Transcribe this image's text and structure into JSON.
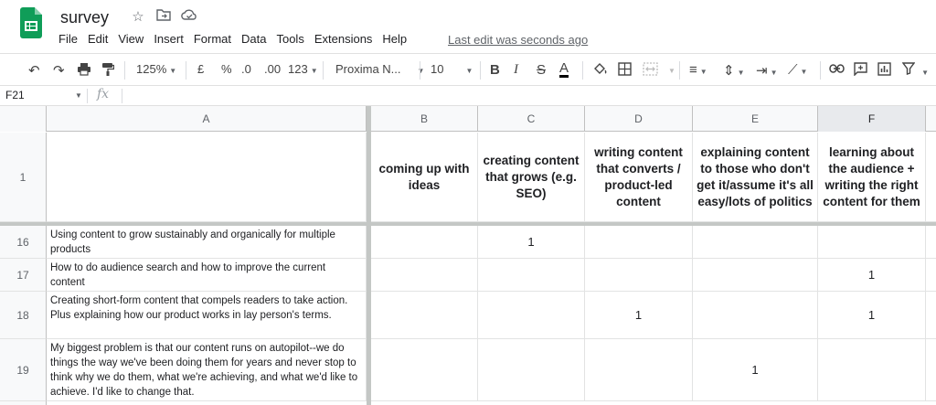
{
  "app": {
    "doc_title": "survey",
    "menu": [
      "File",
      "Edit",
      "View",
      "Insert",
      "Format",
      "Data",
      "Tools",
      "Extensions",
      "Help"
    ],
    "last_edit": "Last edit was seconds ago"
  },
  "toolbar": {
    "zoom": "125%",
    "currency": "£",
    "percent": "%",
    "decrease_decimal": ".0",
    "increase_decimal": ".00",
    "more_formats": "123",
    "font": "Proxima N...",
    "font_size": "10"
  },
  "formula_bar": {
    "cell_ref": "F21",
    "fx": "fx",
    "value": ""
  },
  "sheet": {
    "columns": [
      "A",
      "B",
      "C",
      "D",
      "E",
      "F"
    ],
    "header_row": {
      "number": "1",
      "cells": [
        "",
        "coming up with ideas",
        "creating content that grows (e.g. SEO)",
        "writing content that converts  / product-led content",
        "explaining content to those who don't get it/assume it's all easy/lots of politics",
        "learning about the audience + writing the right content for them"
      ]
    },
    "rows": [
      {
        "number": "16",
        "cells": [
          "Using content to grow sustainably and organically for multiple products",
          "",
          "1",
          "",
          "",
          ""
        ]
      },
      {
        "number": "17",
        "cells": [
          "How to do audience search and how to improve the current content",
          "",
          "",
          "",
          "",
          "1"
        ]
      },
      {
        "number": "18",
        "cells": [
          "Creating short-form content that compels readers to take action. Plus explaining how our product works in lay person's terms.",
          "",
          "",
          "1",
          "",
          "1"
        ]
      },
      {
        "number": "19",
        "cells": [
          "My biggest problem is that our content runs on autopilot--we do things the way we've been doing them for years and never stop to think why we do them, what we're achieving, and what we'd like to achieve. I'd like to change that.",
          "",
          "",
          "",
          "1",
          ""
        ]
      }
    ]
  },
  "colors": {
    "brand_green": "#0f9d58",
    "header_bg": "#f8f9fa",
    "active_header_bg": "#e8eaed",
    "gridline": "#e2e3e3"
  }
}
